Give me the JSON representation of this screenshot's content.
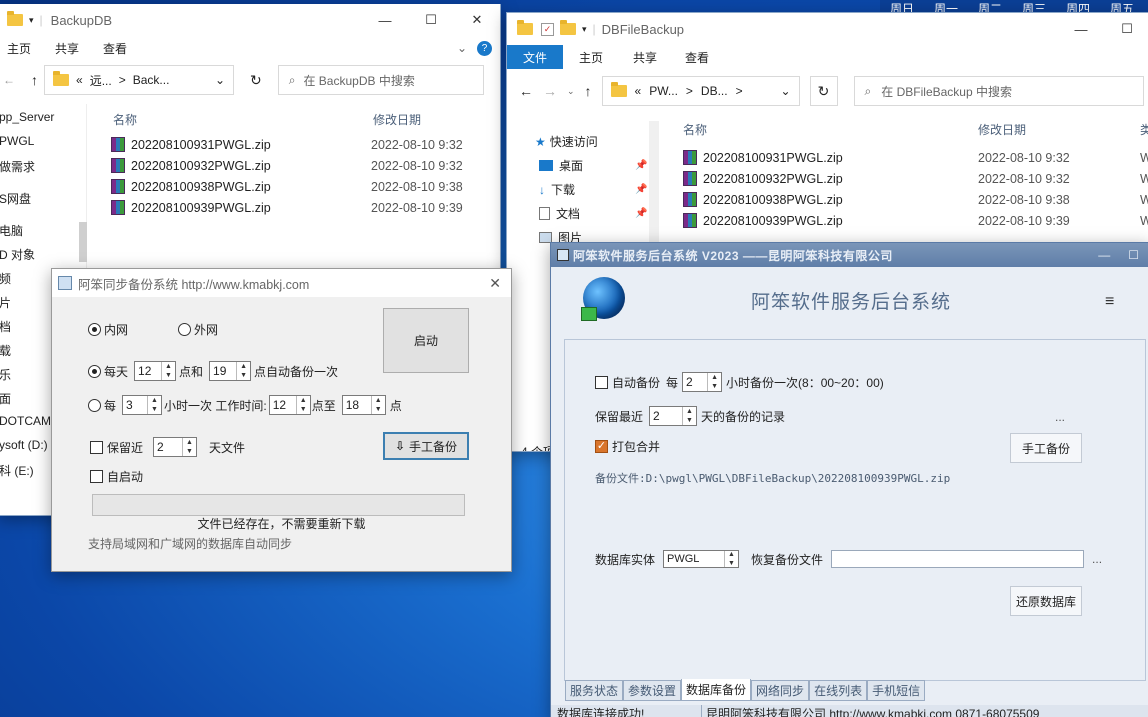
{
  "taskbar_days": [
    "周日",
    "周一",
    "周二",
    "周三",
    "周四",
    "周五"
  ],
  "backup_explorer": {
    "title": "BackupDB",
    "menu": [
      "主页",
      "共享",
      "查看"
    ],
    "breadcrumb": [
      "«",
      "远...",
      ">",
      "Back..."
    ],
    "search_placeholder": "在 BackupDB 中搜索",
    "col_name": "名称",
    "col_date": "修改日期",
    "sidebar": [
      "pp_Server",
      "PWGL",
      "做需求",
      "S网盘",
      "电脑",
      "D 对象",
      "频",
      "片",
      "档",
      "载",
      "乐",
      "面",
      "DOTCAM",
      "ysoft (D:)",
      "科 (E:)"
    ],
    "files": [
      {
        "name": "202208100931PWGL.zip",
        "date": "2022-08-10 9:32"
      },
      {
        "name": "202208100932PWGL.zip",
        "date": "2022-08-10 9:32"
      },
      {
        "name": "202208100938PWGL.zip",
        "date": "2022-08-10 9:38"
      },
      {
        "name": "202208100939PWGL.zip",
        "date": "2022-08-10 9:39"
      }
    ]
  },
  "sync_dialog": {
    "title": "阿笨同步备份系统 http://www.kmabkj.com",
    "lan": "内网",
    "wan": "外网",
    "start": "启动",
    "daily": "每天",
    "daily_h1": "12",
    "and": "点和",
    "daily_h2": "19",
    "daily_suffix": "点自动备份一次",
    "every": "每",
    "every_n": "3",
    "work_time": "小时一次 工作时间:",
    "work_from": "12",
    "to": "点至",
    "work_to": "18",
    "point": "点",
    "keep": "保留近",
    "keep_n": "2",
    "days_files": "天文件",
    "manual": "手工备份",
    "autostart": "自启动",
    "status": "文件已经存在，不需要重新下载",
    "footer": "支持局域网和广域网的数据库自动同步"
  },
  "db_explorer": {
    "title": "DBFileBackup",
    "menu": [
      "文件",
      "主页",
      "共享",
      "查看"
    ],
    "breadcrumb": [
      "«",
      "PW...",
      ">",
      "DB...",
      ">"
    ],
    "search_placeholder": "在 DBFileBackup 中搜索",
    "col_name": "名称",
    "col_date": "修改日期",
    "col_type": "类",
    "quick": [
      "快速访问",
      "桌面",
      "下载",
      "文档",
      "图片"
    ],
    "count": "4 个项",
    "files": [
      {
        "name": "202208100931PWGL.zip",
        "date": "2022-08-10 9:32",
        "type": "W"
      },
      {
        "name": "202208100932PWGL.zip",
        "date": "2022-08-10 9:32",
        "type": "W"
      },
      {
        "name": "202208100938PWGL.zip",
        "date": "2022-08-10 9:38",
        "type": "W"
      },
      {
        "name": "202208100939PWGL.zip",
        "date": "2022-08-10 9:39",
        "type": "W"
      }
    ]
  },
  "service_app": {
    "title": "阿笨软件服务后台系统 V2023 ——昆明阿笨科技有限公司",
    "heading": "阿笨软件服务后台系统",
    "auto_backup": "自动备份",
    "every": "每",
    "hours_n": "2",
    "hours_suffix": "小时备份一次(8：00~20：00)",
    "keep": "保留最近",
    "keep_n": "2",
    "keep_suffix": "天的备份的记录",
    "ellipsis": "...",
    "pack": "打包合并",
    "manual": "手工备份",
    "backup_file": "备份文件:D:\\pwgl\\PWGL\\DBFileBackup\\202208100939PWGL.zip",
    "db_label": "数据库实体",
    "db_value": "PWGL",
    "restore_label": "恢复备份文件",
    "restore_btn": "还原数据库",
    "tabs": [
      "服务状态",
      "参数设置",
      "数据库备份",
      "网络同步",
      "在线列表",
      "手机短信"
    ],
    "active_tab": 2,
    "status_left": "数据库连接成功!",
    "status_right": "昆明阿笨科技有限公司 http://www.kmabkj.com 0871-68075509"
  },
  "colors": {
    "accent": "#1979ca",
    "check": "#d9752c",
    "panel": "#e9eef5"
  }
}
